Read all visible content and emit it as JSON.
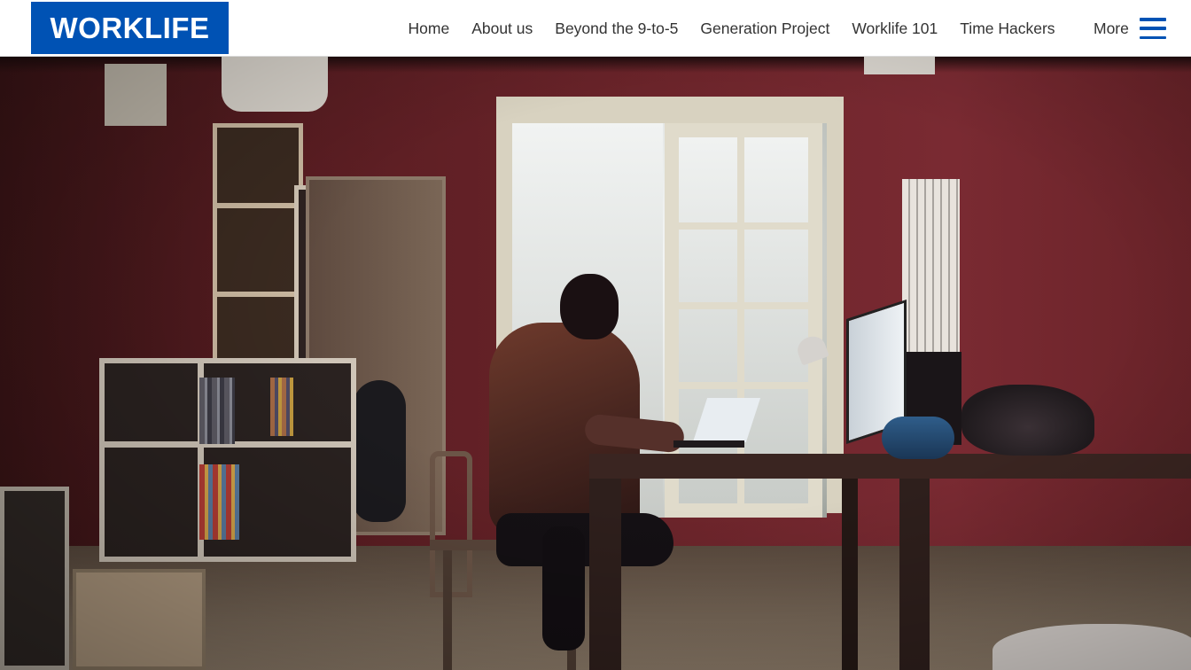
{
  "brand": {
    "logo_text": "WORKLIFE",
    "logo_color": "#0052b4"
  },
  "nav": {
    "items": [
      {
        "label": "Home"
      },
      {
        "label": "About us"
      },
      {
        "label": "Beyond the 9-to-5"
      },
      {
        "label": "Generation Project"
      },
      {
        "label": "Worklife 101"
      },
      {
        "label": "Time Hackers"
      }
    ],
    "more_label": "More",
    "menu_icon": "hamburger-menu-icon",
    "text_color": "#333333"
  },
  "hero": {
    "image_subject": "person working on a laptop at a desk in a room with red walls"
  }
}
